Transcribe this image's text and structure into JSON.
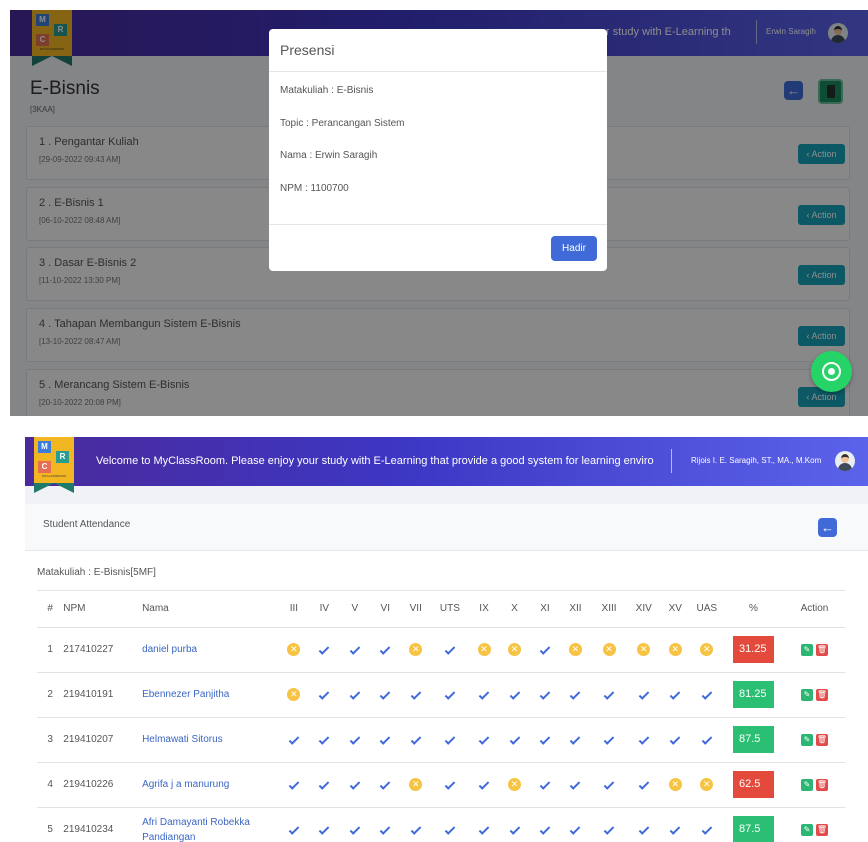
{
  "logo": {
    "letters": [
      "M",
      "R",
      "C"
    ],
    "sub": "MYCLASSROOM"
  },
  "panel1": {
    "marquee": "r study with E-Learning th",
    "user_name": "Erwin Saragih",
    "course_title": "E-Bisnis",
    "course_class": "[3KAA]",
    "back_icon_glyph": "←",
    "topics": [
      {
        "title": "1 . Pengantar Kuliah",
        "date": "[29-09-2022 09:43 AM]",
        "action": "‹ Action"
      },
      {
        "title": "2 . E-Bisnis 1",
        "date": "[06-10-2022 08:48 AM]",
        "action": "‹ Action"
      },
      {
        "title": "3 . Dasar E-Bisnis 2",
        "date": "[11-10-2022 13:30 PM]",
        "action": "‹ Action"
      },
      {
        "title": "4 . Tahapan Membangun Sistem E-Bisnis",
        "date": "[13-10-2022 08:47 AM]",
        "action": "‹ Action"
      },
      {
        "title": "5 . Merancang Sistem E-Bisnis",
        "date": "[20-10-2022 20:08 PM]",
        "action": "‹ Action"
      }
    ],
    "modal": {
      "title": "Presensi",
      "matakuliah": "Matakuliah : E-Bisnis",
      "topic": "Topic : Perancangan Sistem",
      "nama": "Nama : Erwin Saragih",
      "npm": "NPM : 1100700",
      "button": "Hadir"
    }
  },
  "panel2": {
    "marquee": "Velcome to MyClassRoom. Please enjoy your study with E-Learning that provide a good system for learning enviro",
    "user_name": "Rijois I. E. Saragih, ST., MA., M.Kom",
    "card_title": "Student Attendance",
    "matakuliah": "Matakuliah : E-Bisnis[5MF]",
    "columns": [
      "#",
      "NPM",
      "Nama",
      "III",
      "IV",
      "V",
      "VI",
      "VII",
      "UTS",
      "IX",
      "X",
      "XI",
      "XII",
      "XIII",
      "XIV",
      "XV",
      "UAS",
      "%",
      "Action"
    ],
    "rows": [
      {
        "no": "1",
        "npm": "217410227",
        "nama": "daniel purba",
        "marks": [
          "x",
          "v",
          "v",
          "v",
          "x",
          "v",
          "x",
          "x",
          "v",
          "x",
          "x",
          "x",
          "x",
          "x"
        ],
        "pct": "31.25",
        "pct_color": "#e34a3c"
      },
      {
        "no": "2",
        "npm": "219410191",
        "nama": "Ebennezer Panjitha",
        "marks": [
          "x",
          "v",
          "v",
          "v",
          "v",
          "v",
          "v",
          "v",
          "v",
          "v",
          "v",
          "v",
          "v",
          "v"
        ],
        "pct": "81.25",
        "pct_color": "#2bbf73"
      },
      {
        "no": "3",
        "npm": "219410207",
        "nama": "Helmawati Sitorus",
        "marks": [
          "v",
          "v",
          "v",
          "v",
          "v",
          "v",
          "v",
          "v",
          "v",
          "v",
          "v",
          "v",
          "v",
          "v"
        ],
        "pct": "87.5",
        "pct_color": "#2bbf73"
      },
      {
        "no": "4",
        "npm": "219410226",
        "nama": "Agrifa j a manurung",
        "marks": [
          "v",
          "v",
          "v",
          "v",
          "x",
          "v",
          "v",
          "x",
          "v",
          "v",
          "v",
          "v",
          "x",
          "x"
        ],
        "pct": "62.5",
        "pct_color": "#e34a3c"
      },
      {
        "no": "5",
        "npm": "219410234",
        "nama": "Afri Damayanti Robekka Pandiangan",
        "marks": [
          "v",
          "v",
          "v",
          "v",
          "v",
          "v",
          "v",
          "v",
          "v",
          "v",
          "v",
          "v",
          "v",
          "v"
        ],
        "pct": "87.5",
        "pct_color": "#2bbf73"
      }
    ],
    "edit_glyph": "✎",
    "delete_glyph": "🗑",
    "absent_glyph": "✕"
  },
  "colors": {
    "primary": "#3f6ad8",
    "info": "#17a2b8",
    "warning": "#f6c343",
    "success": "#2bbf73",
    "danger": "#e34a3c",
    "whatsapp": "#25d366"
  }
}
